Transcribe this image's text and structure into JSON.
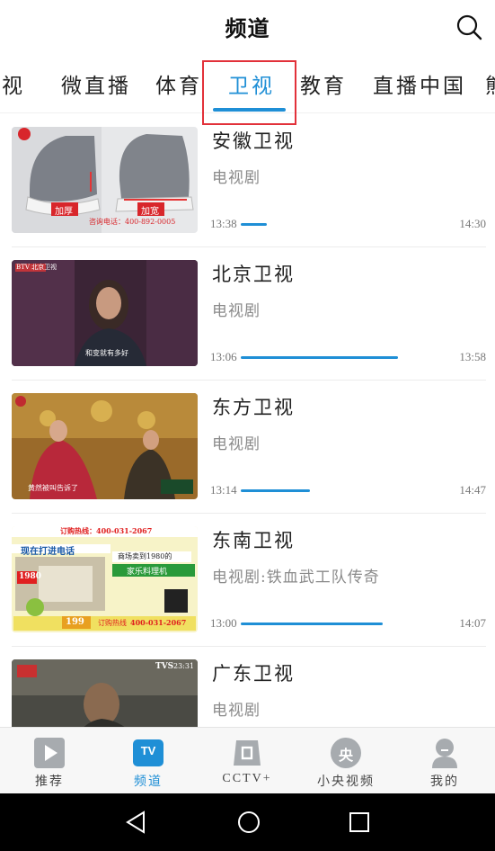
{
  "header": {
    "title": "频道"
  },
  "tabs": [
    {
      "label": "央视",
      "active": false
    },
    {
      "label": "微直播",
      "active": false
    },
    {
      "label": "体育",
      "active": false
    },
    {
      "label": "卫视",
      "active": true
    },
    {
      "label": "教育",
      "active": false
    },
    {
      "label": "直播中国",
      "active": false
    },
    {
      "label": "熊",
      "active": false
    }
  ],
  "channels": [
    {
      "name": "安徽卫视",
      "program": "电视剧",
      "start": "13:38",
      "end": "14:30",
      "progress": 0.12,
      "thumb_text": [
        "加厚",
        "加宽",
        "咨询电话：400-892-0005"
      ]
    },
    {
      "name": "北京卫视",
      "program": "电视剧",
      "start": "13:06",
      "end": "13:58",
      "progress": 0.73,
      "thumb_text": [
        "BTV 北京卫视",
        "和变就有多好"
      ]
    },
    {
      "name": "东方卫视",
      "program": "电视剧",
      "start": "13:14",
      "end": "14:47",
      "progress": 0.32,
      "thumb_text": [
        "黄然被叫告诉了"
      ]
    },
    {
      "name": "东南卫视",
      "program": "电视剧:铁血武工队传奇",
      "start": "13:00",
      "end": "14:07",
      "progress": 0.66,
      "thumb_text": [
        "订购热线：400-031-2067",
        "现在打进电话",
        "商场卖到1980的",
        "家乐料理机",
        "1980",
        "199",
        "订购热线",
        "400-031-2067"
      ]
    },
    {
      "name": "广东卫视",
      "program": "电视剧",
      "start": "",
      "end": "",
      "progress": 0,
      "thumb_text": [
        "TVS",
        "23:31"
      ]
    }
  ],
  "bottom_nav": [
    {
      "label": "推荐",
      "icon": "play-icon",
      "active": false
    },
    {
      "label": "频道",
      "icon": "tv-icon",
      "active": true
    },
    {
      "label": "CCTV+",
      "icon": "cctv-plus-icon",
      "active": false
    },
    {
      "label": "小央视频",
      "icon": "yang-icon",
      "active": false
    },
    {
      "label": "我的",
      "icon": "user-icon",
      "active": false
    }
  ],
  "nav_icon_text": {
    "tv": "TV",
    "yang": "央"
  },
  "colors": {
    "accent": "#1f8fd6",
    "highlight": "#e2313a"
  }
}
